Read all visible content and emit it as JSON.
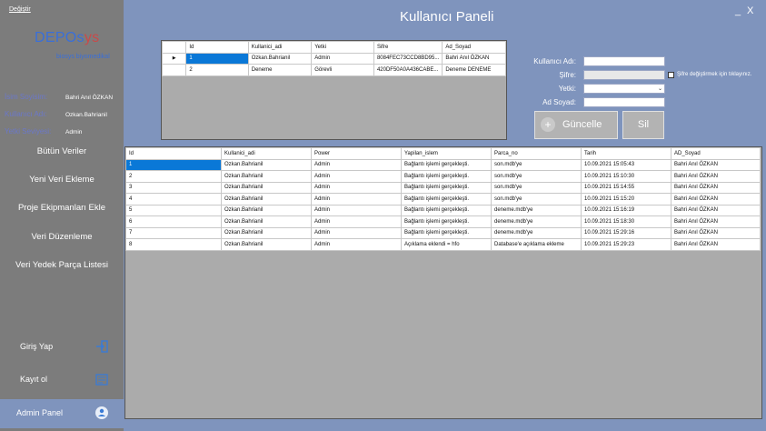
{
  "sidebar": {
    "change_link": "Değiştir",
    "logo_main": "DEPOs",
    "logo_alt": "ys",
    "logo_sub": "biosys biyomedikal",
    "info": [
      {
        "label": "İsim Soyisim:",
        "value": "Bahri Anıl ÖZKAN"
      },
      {
        "label": "Kullanıcı Adı:",
        "value": "Ozkan.Bahrianil"
      },
      {
        "label": "Yetki Seviyesi:",
        "value": "Admin"
      }
    ],
    "menu": [
      "Bütün Veriler",
      "Yeni Veri Ekleme",
      "Proje Ekipmanları Ekle",
      "Veri Düzenleme",
      "Veri Yedek Parça Listesi"
    ],
    "bottom": [
      {
        "label": "Giriş Yap",
        "icon": "login-icon"
      },
      {
        "label": "Kayıt ol",
        "icon": "register-icon"
      },
      {
        "label": "Admin Panel",
        "icon": "admin-icon"
      }
    ]
  },
  "header": {
    "title": "Kullanıcı Paneli",
    "minimize": "_",
    "close": "X"
  },
  "users_grid": {
    "columns": [
      "Id",
      "Kullanici_adi",
      "Yetki",
      "Sifre",
      "Ad_Soyad"
    ],
    "rows": [
      [
        "1",
        "Ozkan.Bahrianil",
        "Admin",
        "8084FEC73CCD8BD95...",
        "Bahri Anıl ÖZKAN"
      ],
      [
        "2",
        "Deneme",
        "Görevli",
        "420DF50A0A436CABE...",
        "Deneme DENEME"
      ]
    ]
  },
  "form": {
    "username_label": "Kullanıcı Adı:",
    "password_label": "Şifre:",
    "role_label": "Yetki:",
    "fullname_label": "Ad Soyad:",
    "username_value": "",
    "password_value": "",
    "role_value": "",
    "fullname_value": "",
    "password_hint": "Şifre değiştirmek için tıklayınız.",
    "update_button": "Güncelle",
    "delete_button": "Sil"
  },
  "log_grid": {
    "columns": [
      "Id",
      "Kullanici_adi",
      "Power",
      "Yapilan_islem",
      "Parca_no",
      "Tarih",
      "AD_Soyad"
    ],
    "rows": [
      [
        "1",
        "Ozkan.Bahrianil",
        "Admin",
        "Bağlantı işlemi gerçekleşti.",
        "son.mdb'ye",
        "10.09.2021 15:05:43",
        "Bahri Anıl ÖZKAN"
      ],
      [
        "2",
        "Ozkan.Bahrianil",
        "Admin",
        "Bağlantı işlemi gerçekleşti.",
        "son.mdb'ye",
        "10.09.2021 15:10:30",
        "Bahri Anıl ÖZKAN"
      ],
      [
        "3",
        "Ozkan.Bahrianil",
        "Admin",
        "Bağlantı işlemi gerçekleşti.",
        "son.mdb'ye",
        "10.09.2021 15:14:55",
        "Bahri Anıl ÖZKAN"
      ],
      [
        "4",
        "Ozkan.Bahrianil",
        "Admin",
        "Bağlantı işlemi gerçekleşti.",
        "son.mdb'ye",
        "10.09.2021 15:15:20",
        "Bahri Anıl ÖZKAN"
      ],
      [
        "5",
        "Ozkan.Bahrianil",
        "Admin",
        "Bağlantı işlemi gerçekleşti.",
        "deneme.mdb'ye",
        "10.09.2021 15:16:19",
        "Bahri Anıl ÖZKAN"
      ],
      [
        "6",
        "Ozkan.Bahrianil",
        "Admin",
        "Bağlantı işlemi gerçekleşti.",
        "deneme.mdb'ye",
        "10.09.2021 15:18:30",
        "Bahri Anıl ÖZKAN"
      ],
      [
        "7",
        "Ozkan.Bahrianil",
        "Admin",
        "Bağlantı işlemi gerçekleşti.",
        "deneme.mdb'ye",
        "10.09.2021 15:29:16",
        "Bahri Anıl ÖZKAN"
      ],
      [
        "8",
        "Ozkan.Bahrianil",
        "Admin",
        "Açıklama eklendi = hfo",
        "Database'e açıklama ekleme",
        "10.09.2021 15:29:23",
        "Bahri Anıl ÖZKAN"
      ]
    ]
  },
  "colors": {
    "accent": "#0a78d7",
    "background": "#7f94bd",
    "sidebar": "#7c7c7c"
  }
}
